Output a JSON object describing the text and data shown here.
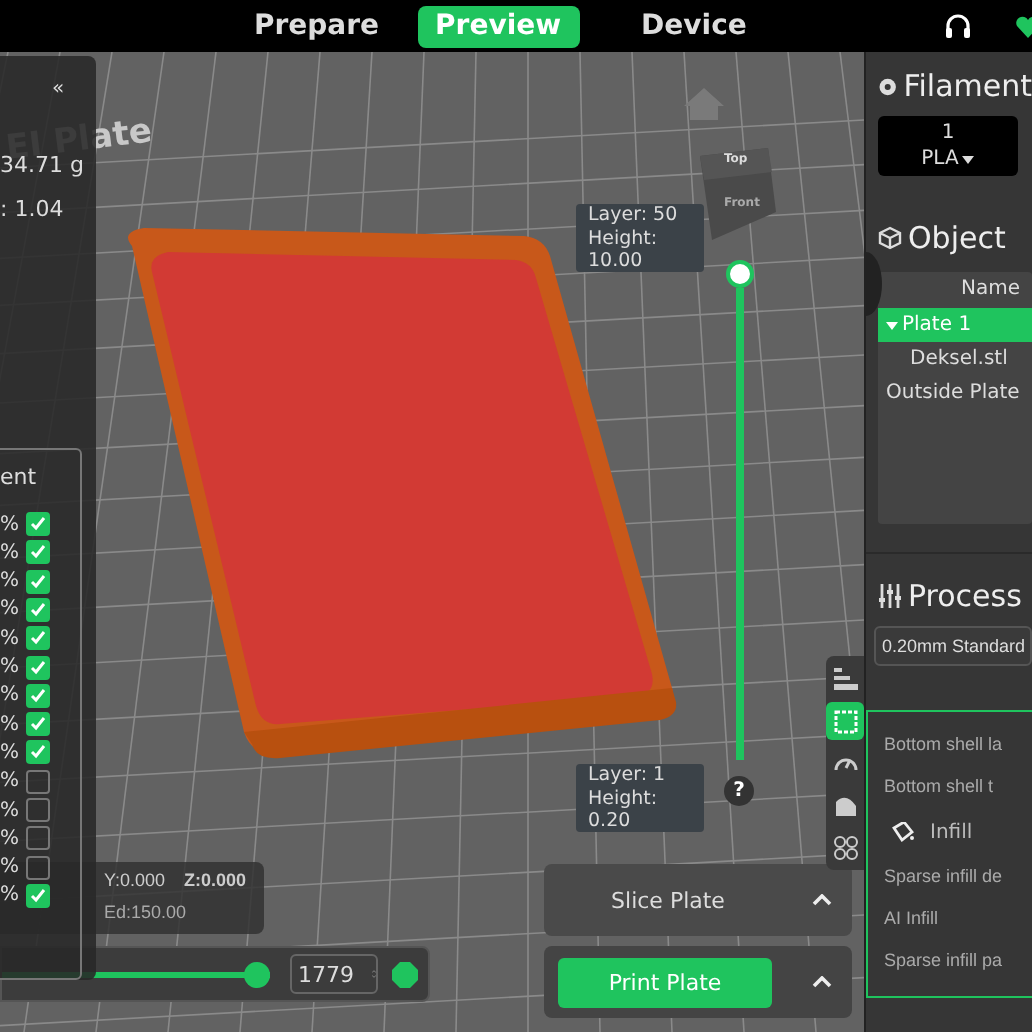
{
  "top_bar": {
    "tabs": [
      {
        "label": "Prepare",
        "selected": false
      },
      {
        "label": "Preview",
        "selected": true
      },
      {
        "label": "Device",
        "selected": false
      }
    ]
  },
  "viewport": {
    "bed_label": "EI Plate",
    "view_cube": {
      "top": "Top",
      "front": "Front"
    },
    "stats_panel": {
      "collapse": "«",
      "weight": "34.71 g",
      "ratio": ": 1.04",
      "column_header": "ent",
      "rows": [
        {
          "percent": "%",
          "checked": true
        },
        {
          "percent": "%",
          "checked": true
        },
        {
          "percent": "%",
          "checked": true
        },
        {
          "percent": "%",
          "checked": true
        },
        {
          "percent": "%",
          "checked": true
        },
        {
          "percent": "%",
          "checked": true
        },
        {
          "percent": "%",
          "checked": true
        },
        {
          "percent": "%",
          "checked": true
        },
        {
          "percent": "%",
          "checked": true
        },
        {
          "percent": "%",
          "checked": false
        },
        {
          "percent": "%",
          "checked": false
        },
        {
          "percent": "%",
          "checked": false
        },
        {
          "percent": "%",
          "checked": false
        },
        {
          "percent": "%",
          "checked": true
        }
      ]
    },
    "coordinates": {
      "xy": "Y:0.000",
      "z": "Z:0.000",
      "feed": "Ed:150.00"
    },
    "layer_slider": {
      "level": 1,
      "top": {
        "layer": "Layer: 50",
        "height": "Height: 10.00"
      },
      "bottom": {
        "layer": "Layer: 1",
        "height": "Height: 0.20"
      },
      "help": "?"
    },
    "move_slider": {
      "level": 1,
      "value": "1779"
    },
    "side_toolbar": [
      {
        "kind": "layers",
        "selected": false
      },
      {
        "kind": "frame",
        "selected": true
      },
      {
        "kind": "speed",
        "selected": false
      },
      {
        "kind": "support",
        "selected": false
      },
      {
        "kind": "objects",
        "selected": false
      }
    ],
    "actions": {
      "slice": "Slice Plate",
      "print": "Print Plate"
    }
  },
  "sidebar": {
    "filament": {
      "title": "Filament",
      "slot": "1",
      "type": "PLA"
    },
    "object": {
      "title": "Object",
      "column": "Name",
      "rows": [
        {
          "label": "Plate 1",
          "selected": true,
          "expanded": true,
          "children": [
            {
              "label": "Deksel.stl",
              "selected": false
            }
          ]
        },
        {
          "label": "Outside Plate",
          "selected": false
        }
      ]
    },
    "process": {
      "title": "Process",
      "preset": "0.20mm Standard",
      "settings": [
        {
          "kind": "setting",
          "label": "Bottom shell la"
        },
        {
          "kind": "setting",
          "label": "Bottom shell t"
        },
        {
          "kind": "section",
          "label": "Infill"
        },
        {
          "kind": "setting",
          "label": "Sparse infill de"
        },
        {
          "kind": "setting",
          "label": "AI Infill"
        },
        {
          "kind": "setting",
          "label": "Sparse infill pa"
        }
      ]
    }
  }
}
